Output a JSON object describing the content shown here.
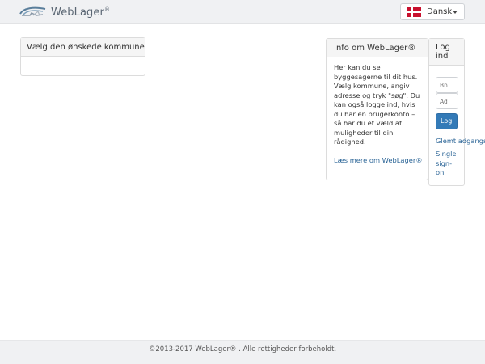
{
  "navbar": {
    "brand_name": "WebLager",
    "brand_mark": "®",
    "language": {
      "label": "Dansk",
      "flag_icon": "denmark-flag-icon"
    }
  },
  "kommune_panel": {
    "title": "Vælg den ønskede kommune"
  },
  "info_panel": {
    "title": "Info om WebLager®",
    "body": "Her kan du se byggesagerne til dit hus. Vælg kommune, angiv adresse og tryk \"søg\". Du kan også logge ind, hvis du har en brugerkonto – så har du et væld af muligheder til din rådighed.",
    "link": "Læs mere om WebLager®"
  },
  "login_panel": {
    "title": "Log ind",
    "username_placeholder": "Bn",
    "password_placeholder": "Ad",
    "login_button": "Log",
    "forgot_link": "Glemt adgangs",
    "sso_link": "Single sign-on"
  },
  "footer": {
    "text": "©2013-2017 WebLager® . Alle rettigheder forbeholdt."
  },
  "colors": {
    "primary": "#337ab7",
    "link": "#2a6496",
    "navbar_bg": "#f0f1f3"
  }
}
